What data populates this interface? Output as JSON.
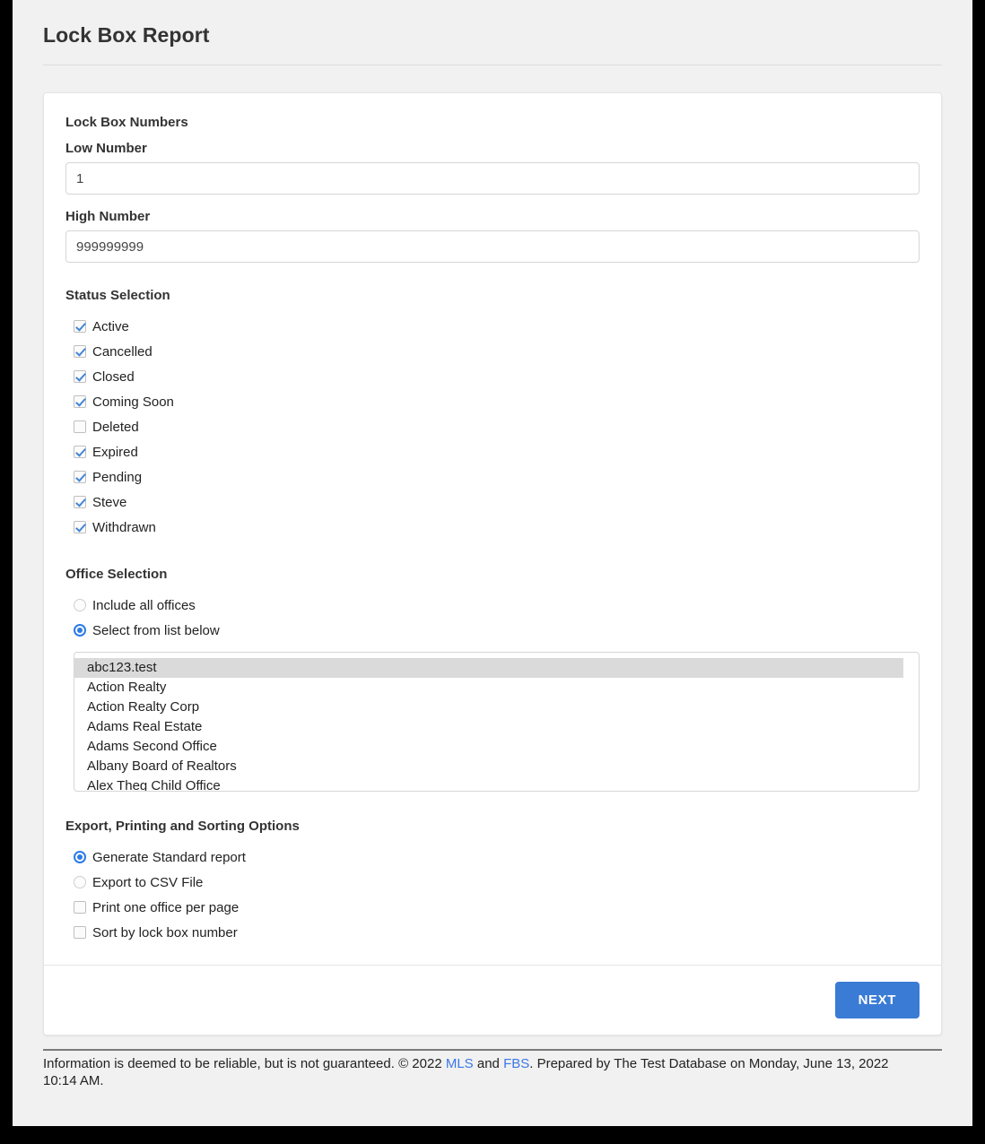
{
  "page": {
    "title": "Lock Box Report"
  },
  "lock_box_numbers": {
    "heading": "Lock Box Numbers",
    "low": {
      "label": "Low Number",
      "value": "1"
    },
    "high": {
      "label": "High Number",
      "value": "999999999"
    }
  },
  "status_selection": {
    "heading": "Status Selection",
    "items": [
      {
        "label": "Active",
        "checked": true
      },
      {
        "label": "Cancelled",
        "checked": true
      },
      {
        "label": "Closed",
        "checked": true
      },
      {
        "label": "Coming Soon",
        "checked": true
      },
      {
        "label": "Deleted",
        "checked": false
      },
      {
        "label": "Expired",
        "checked": true
      },
      {
        "label": "Pending",
        "checked": true
      },
      {
        "label": "Steve",
        "checked": true
      },
      {
        "label": "Withdrawn",
        "checked": true
      }
    ]
  },
  "office_selection": {
    "heading": "Office Selection",
    "options": [
      {
        "label": "Include all offices",
        "selected": false
      },
      {
        "label": "Select from list below",
        "selected": true
      }
    ],
    "offices": [
      {
        "label": "abc123.test",
        "selected": true
      },
      {
        "label": "Action Realty",
        "selected": false
      },
      {
        "label": "Action Realty Corp",
        "selected": false
      },
      {
        "label": "Adams Real Estate",
        "selected": false
      },
      {
        "label": "Adams Second Office",
        "selected": false
      },
      {
        "label": "Albany Board of Realtors",
        "selected": false
      },
      {
        "label": "Alex Theg Child Office",
        "selected": false
      }
    ]
  },
  "export_options": {
    "heading": "Export, Printing and Sorting Options",
    "radios": [
      {
        "label": "Generate Standard report",
        "selected": true
      },
      {
        "label": "Export to CSV File",
        "selected": false
      }
    ],
    "checkboxes": [
      {
        "label": "Print one office per page",
        "checked": false
      },
      {
        "label": "Sort by lock box number",
        "checked": false
      }
    ]
  },
  "actions": {
    "next_label": "NEXT"
  },
  "footer": {
    "text_before_mls": "Information is deemed to be reliable, but is not guaranteed. © 2022 ",
    "mls_link": "MLS",
    "text_between": " and ",
    "fbs_link": "FBS",
    "text_after": ". Prepared by The Test Database on Monday, June 13, 2022 10:14 AM."
  },
  "colors": {
    "accent_blue": "#3a7bd5",
    "link_blue": "#3b78e7",
    "page_background": "#f1f1f1",
    "heading_text": "#333333"
  }
}
